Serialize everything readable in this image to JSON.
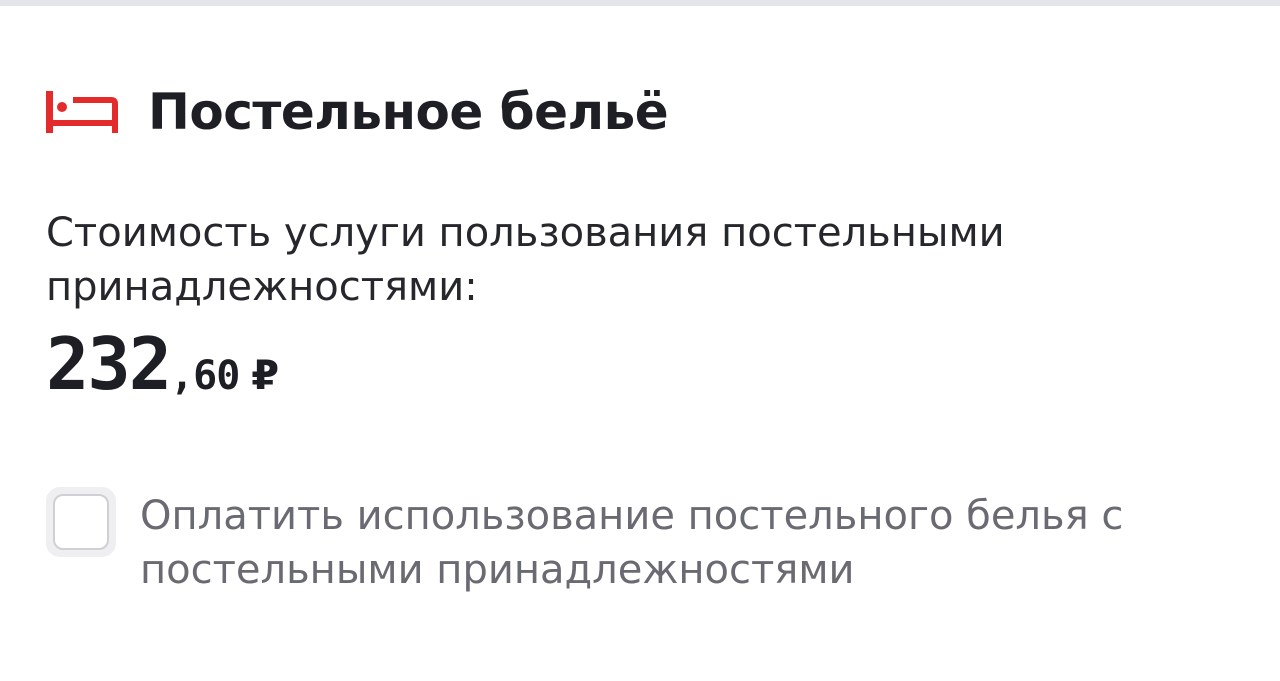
{
  "section": {
    "icon": "bed-icon",
    "title": "Постельное бельё"
  },
  "service": {
    "price_label": "Стоимость услуги пользования постельными принадлежностями:",
    "price_integer": "232",
    "price_fraction": ",60",
    "currency": "₽"
  },
  "option": {
    "checked": false,
    "label": "Оплатить использование постельного белья с постельными принадлежностями"
  },
  "colors": {
    "accent": "#e32b2b",
    "text_primary": "#1e1f24",
    "text_secondary": "#6a6b72",
    "divider": "#e4e5e8"
  }
}
